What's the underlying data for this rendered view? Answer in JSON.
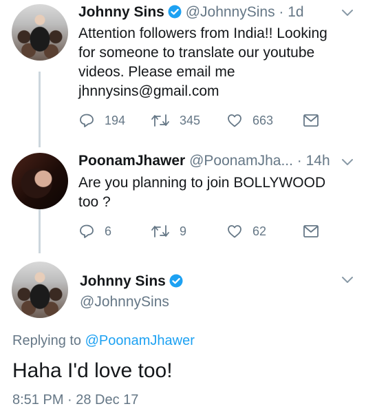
{
  "tweet1": {
    "name": "Johnny Sins",
    "handle": "@JohnnySins",
    "time": " · 1d",
    "text_lines": [
      "Attention followers from India!! Looking",
      "for someone to translate our youtube",
      "videos. Please email me",
      "jhnnysins@gmail.com"
    ],
    "replies": "194",
    "retweets": "345",
    "likes": "663"
  },
  "tweet2": {
    "name": "PoonamJhawer",
    "handle": "@PoonamJha...",
    "time": " · 14h",
    "text_lines": [
      "Are you planning to join BOLLYWOOD",
      "too ?"
    ],
    "replies": "6",
    "retweets": "9",
    "likes": "62"
  },
  "tweet3": {
    "name": "Johnny Sins",
    "handle": "@JohnnySins",
    "replying_prefix": "Replying to ",
    "replying_to": "@PoonamJhawer",
    "text": "Haha I'd love too!",
    "timestamp": "8:51 PM · 28 Dec 17"
  },
  "icons": {
    "verified": "verified-badge-icon",
    "chevron": "chevron-down-icon",
    "reply": "reply-icon",
    "retweet": "retweet-icon",
    "like": "heart-icon",
    "dm": "envelope-icon"
  },
  "colors": {
    "text": "#14171a",
    "secondary": "#657786",
    "link": "#1da1f2",
    "verified": "#1da1f2",
    "thread_line": "#ccd6dd"
  }
}
